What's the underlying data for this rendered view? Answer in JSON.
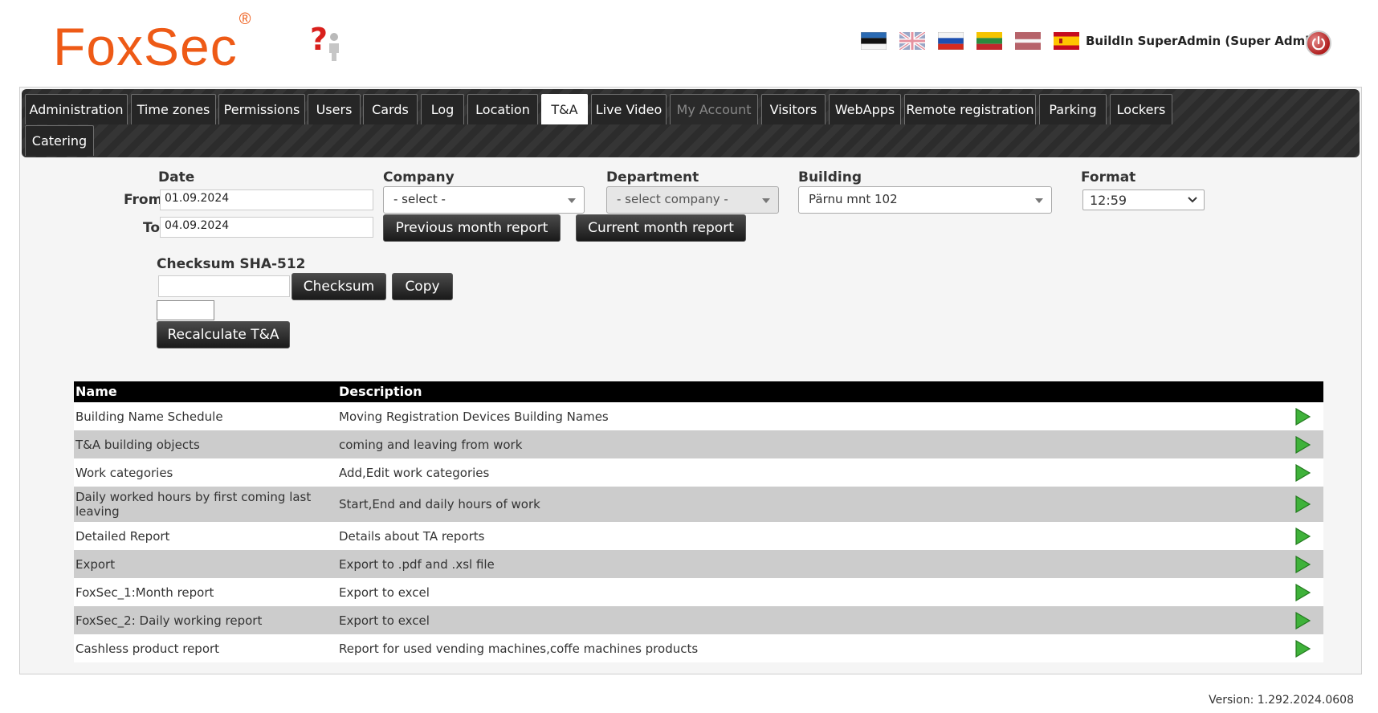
{
  "header": {
    "logo_text": "FoxSec",
    "logo_mark": "®",
    "user_label": "BuildIn SuperAdmin (Super Admin)",
    "flags": [
      "estonian-flag-icon",
      "english-flag-icon",
      "russian-flag-icon",
      "lithuanian-flag-icon",
      "latvian-flag-icon",
      "spanish-flag-icon"
    ],
    "accent_color": "#ee5a16"
  },
  "nav": {
    "tabs": [
      {
        "label": "Administration"
      },
      {
        "label": "Time zones"
      },
      {
        "label": "Permissions"
      },
      {
        "label": "Users"
      },
      {
        "label": "Cards"
      },
      {
        "label": "Log"
      },
      {
        "label": "Location"
      },
      {
        "label": "T&A",
        "active": true
      },
      {
        "label": "Live Video"
      },
      {
        "label": "My Account",
        "disabled": true
      },
      {
        "label": "Visitors"
      },
      {
        "label": "WebApps"
      },
      {
        "label": "Remote registration"
      },
      {
        "label": "Parking"
      },
      {
        "label": "Lockers"
      },
      {
        "label": "Catering"
      }
    ]
  },
  "form": {
    "date_label": "Date",
    "from_label": "From",
    "from_value": "01.09.2024",
    "to_label": "To",
    "to_value": "04.09.2024",
    "company_label": "Company",
    "company_value": "- select -",
    "department_label": "Department",
    "department_value": "- select company -",
    "building_label": "Building",
    "building_value": "Pärnu mnt 102",
    "format_label": "Format",
    "format_value": "12:59",
    "prev_month_button": "Previous month report",
    "current_month_button": "Current month report",
    "checksum_label": "Checksum SHA-512",
    "checksum_value": "",
    "checksum_button": "Checksum",
    "copy_button": "Copy",
    "small_value": "",
    "recalculate_button": "Recalculate T&A"
  },
  "table": {
    "headers": {
      "name": "Name",
      "description": "Description"
    },
    "rows": [
      {
        "name": "Building Name Schedule",
        "description": "Moving Registration Devices Building Names"
      },
      {
        "name": "T&A building objects",
        "description": "coming and leaving from work"
      },
      {
        "name": "Work categories",
        "description": "Add,Edit work categories"
      },
      {
        "name": "Daily worked hours by first coming last leaving",
        "description": "Start,End and daily hours of work"
      },
      {
        "name": "Detailed Report",
        "description": "Details about TA reports"
      },
      {
        "name": "Export",
        "description": "Export to .pdf and .xsl file"
      },
      {
        "name": "FoxSec_1:Month report",
        "description": "Export to excel"
      },
      {
        "name": "FoxSec_2: Daily working report",
        "description": "Export to excel"
      },
      {
        "name": "Cashless product report",
        "description": "Report for used vending machines,coffe machines products"
      }
    ]
  },
  "footer": {
    "version": "Version: 1.292.2024.0608"
  }
}
